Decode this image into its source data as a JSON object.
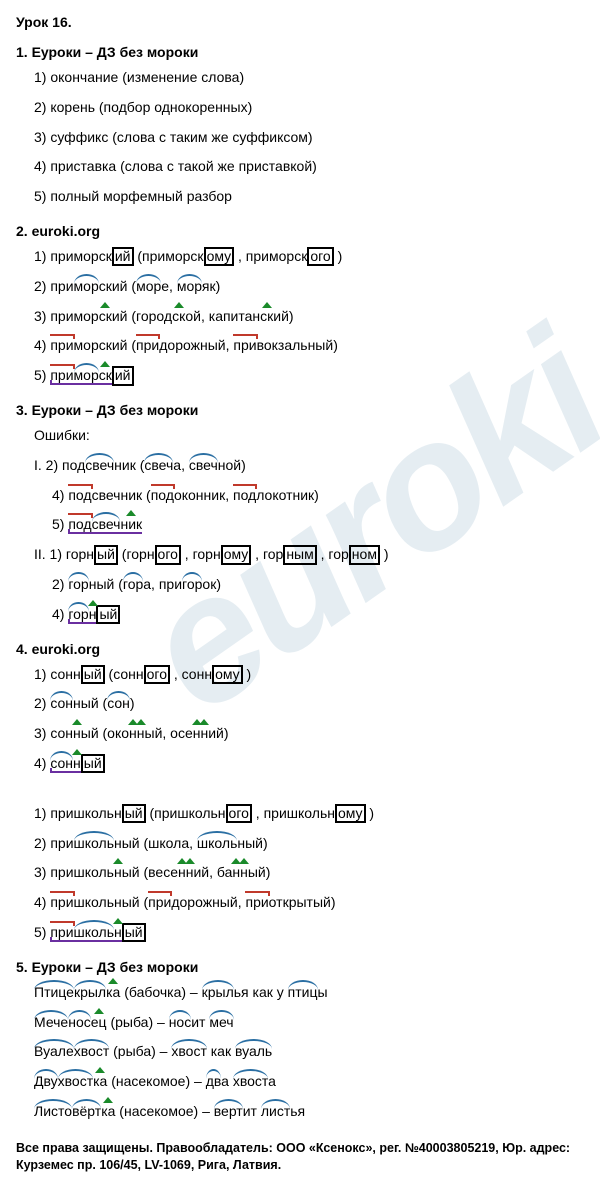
{
  "watermark": "euroki",
  "lesson_title": "Урок 16.",
  "sections": [
    {
      "title": "1. Еуроки – ДЗ без мороки",
      "lines": [
        {
          "n": "1)",
          "plain": "окончание (изменение слова)"
        },
        {
          "n": "2)",
          "plain": "корень (подбор однокоренных)"
        },
        {
          "n": "3)",
          "plain": "суффикс (слова с таким же суффиксом)"
        },
        {
          "n": "4)",
          "plain": "приставка (слова с такой же приставкой)"
        },
        {
          "n": "5)",
          "plain": "полный морфемный разбор"
        }
      ]
    },
    {
      "title": "2. euroki.org",
      "lines": [
        {
          "n": "1)",
          "word": "приморский",
          "ex": "(приморскому , приморского )",
          "mode": "end"
        },
        {
          "n": "2)",
          "word": "приморский",
          "ex": "(море, моряк)",
          "mode": "root"
        },
        {
          "n": "3)",
          "word": "приморский",
          "ex": "(городской, капитанский)",
          "mode": "suf"
        },
        {
          "n": "4)",
          "word": "приморский",
          "ex": "(придорожный, привокзальный)",
          "mode": "pref"
        },
        {
          "n": "5)",
          "word": "приморский",
          "ex": "",
          "mode": "full"
        }
      ],
      "parts": {
        "pref": "при",
        "root": "мор",
        "suf": "ск",
        "end": "ий"
      }
    },
    {
      "title": "3. Еуроки – ДЗ без мороки",
      "intro": "Ошибки:",
      "groups": [
        {
          "label": "I.",
          "lines": [
            {
              "n": "2)",
              "word": "подсвечник",
              "ex": "(свеча, свечной)",
              "mode": "root",
              "parts": {
                "pref": "под",
                "root": "свеч",
                "suf": "ник",
                "end": ""
              }
            },
            {
              "n": "4)",
              "word": "подсвечник",
              "ex": "(подоконник, подлокотник)",
              "mode": "pref",
              "parts": {
                "pref": "под",
                "root": "свеч",
                "suf": "ник",
                "end": ""
              }
            },
            {
              "n": "5)",
              "word": "подсвечник",
              "ex": "",
              "mode": "full",
              "parts": {
                "pref": "под",
                "root": "свеч",
                "suf": "ник",
                "end": ""
              }
            }
          ]
        },
        {
          "label": "II.",
          "lines": [
            {
              "n": "1)",
              "word": "горный",
              "ex": "(горного , горному , горным , горном )",
              "mode": "end",
              "parts": {
                "pref": "",
                "root": "гор",
                "suf": "н",
                "end": "ый"
              }
            },
            {
              "n": "2)",
              "word": "горный",
              "ex": "(гора, пригорок)",
              "mode": "root",
              "parts": {
                "pref": "",
                "root": "гор",
                "suf": "н",
                "end": "ый"
              }
            },
            {
              "n": "4)",
              "word": "горный",
              "ex": "",
              "mode": "full",
              "parts": {
                "pref": "",
                "root": "гор",
                "suf": "н",
                "end": "ый"
              }
            }
          ]
        }
      ]
    },
    {
      "title": "4. euroki.org",
      "blocks": [
        {
          "parts": {
            "pref": "",
            "root": "сон",
            "suf": "н",
            "end": "ый"
          },
          "lines": [
            {
              "n": "1)",
              "word": "сонный",
              "ex": "(сонного , сонному )",
              "mode": "end"
            },
            {
              "n": "2)",
              "word": "сонный",
              "ex": "(сон)",
              "mode": "root"
            },
            {
              "n": "3)",
              "word": "сонный",
              "ex": "(оконный, осенний)",
              "mode": "suf"
            },
            {
              "n": "4)",
              "word": "сонный",
              "ex": "",
              "mode": "full"
            }
          ]
        },
        {
          "parts": {
            "pref": "при",
            "root": "школь",
            "suf": "н",
            "end": "ый"
          },
          "lines": [
            {
              "n": "1)",
              "word": "пришкольный",
              "ex": "(пришкольного , пришкольному )",
              "mode": "end"
            },
            {
              "n": "2)",
              "word": "пришкольный",
              "ex": "(школа, школьный)",
              "mode": "root"
            },
            {
              "n": "3)",
              "word": "пришкольный",
              "ex": "(весенний, банный)",
              "mode": "suf"
            },
            {
              "n": "4)",
              "word": "пришкольный",
              "ex": "(придорожный, приоткрытый)",
              "mode": "pref"
            },
            {
              "n": "5)",
              "word": "пришкольный",
              "ex": "",
              "mode": "full"
            }
          ]
        }
      ]
    },
    {
      "title": "5. Еуроки – ДЗ без мороки",
      "pairs": [
        {
          "w": "Птицекрылка",
          "note": "(бабочка)",
          "def": "крылья как у птицы",
          "r1": "Птице",
          "r2": "крыл",
          "suf": "ка",
          "dr": "крыл",
          "dr2": "птиц"
        },
        {
          "w": "Меченосец",
          "note": "(рыба)",
          "def": "носит меч",
          "r1": "Мече",
          "r2": "нос",
          "suf": "ец",
          "dr": "нос",
          "dr2": "меч"
        },
        {
          "w": "Вуалехвост",
          "note": "(рыба)",
          "def": "хвост как вуаль",
          "r1": "Вуале",
          "r2": "хвост",
          "suf": "",
          "dr": "хвост",
          "dr2": "вуаль"
        },
        {
          "w": "Двухвостка",
          "note": "(насекомое)",
          "def": "два хвоста",
          "r1": "Дву",
          "r2": "хвост",
          "suf": "ка",
          "dr": "хвост",
          "dr2": "дв"
        },
        {
          "w": "Листовёртка",
          "note": "(насекомое)",
          "def": "вертит листья",
          "r1": "Листо",
          "r2": "вёрт",
          "suf": "ка",
          "dr": "верт",
          "dr2": "лист"
        }
      ]
    }
  ],
  "footer": "Все права защищены. Правообладатель: ООО «Ксенокс», рег. №40003805219, Юр. адрес: Курземес пр. 106/45, LV-1069, Рига, Латвия."
}
